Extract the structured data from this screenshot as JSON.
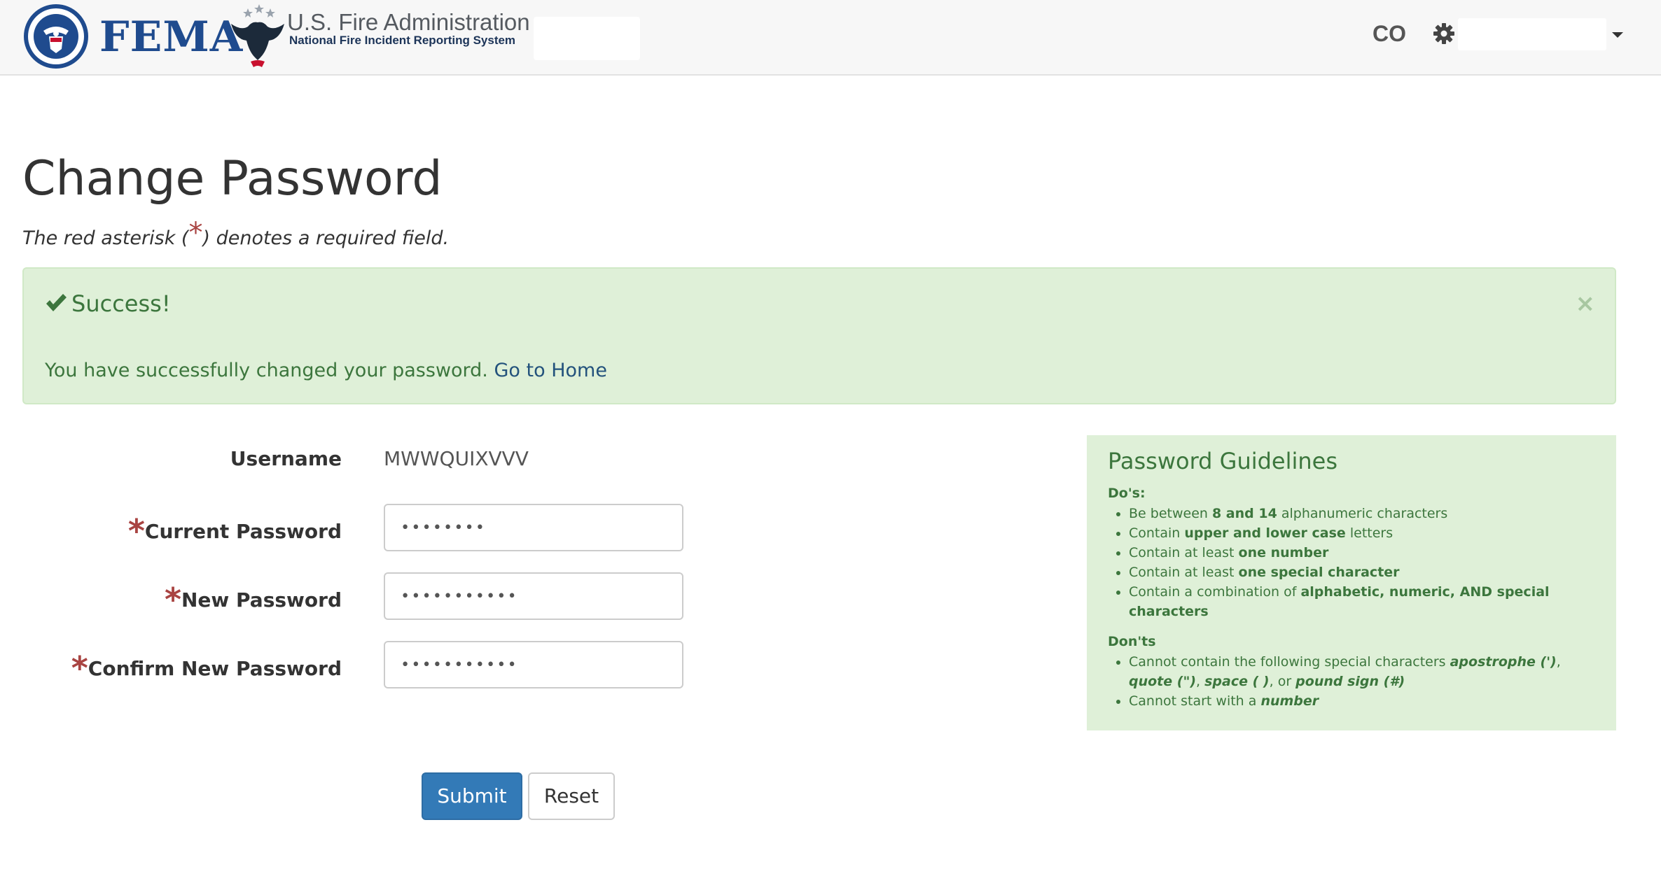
{
  "header": {
    "fema_wordmark": "FEMA",
    "usfa_title": "U.S. Fire Administration",
    "usfa_subtitle": "National Fire Incident Reporting System",
    "state_code": "CO",
    "icons": {
      "settings": "gear-icon",
      "user_menu": "caret-down-icon"
    }
  },
  "page": {
    "title": "Change Password",
    "required_note_prefix": "The red asterisk (",
    "required_note_asterisk": "*",
    "required_note_suffix": ") denotes a required field."
  },
  "alert": {
    "title": "Success!",
    "close_label": "×",
    "message": "You have successfully changed your password.",
    "link_text": "Go to Home",
    "icons": {
      "status": "check-icon",
      "close": "close-icon"
    }
  },
  "form": {
    "asterisk": "*",
    "username_label": "Username",
    "username_value": "MWWQUIXVVV",
    "current_password_label": "Current Password",
    "current_password_value": "••••••••",
    "new_password_label": "New Password",
    "new_password_value": "•••••••••••",
    "confirm_password_label": "Confirm New Password",
    "confirm_password_value": "•••••••••••",
    "submit_label": "Submit",
    "reset_label": "Reset"
  },
  "guidelines": {
    "title": "Password Guidelines",
    "dos_title": "Do's:",
    "dos": [
      {
        "pre": "Be between ",
        "strong": "8 and 14",
        "post": " alphanumeric characters"
      },
      {
        "pre": "Contain ",
        "strong": "upper and lower case",
        "post": " letters"
      },
      {
        "pre": "Contain at least ",
        "strong": "one number",
        "post": ""
      },
      {
        "pre": "Contain at least ",
        "strong": "one special character",
        "post": ""
      },
      {
        "pre": "Contain a combination of ",
        "strong": "alphabetic, numeric, AND special characters",
        "post": ""
      }
    ],
    "donts_title": "Don'ts",
    "donts_1": {
      "pre": "Cannot contain the following special characters ",
      "s1": "apostrophe (')",
      "sep1": ", ",
      "s2": "quote (\")",
      "sep2": ", ",
      "s3": "space ( )",
      "sep3": ", or ",
      "s4": "pound sign (#)"
    },
    "donts_2": {
      "pre": "Cannot start with a ",
      "strong": "number"
    }
  },
  "colors": {
    "brand_blue": "#1f4b8e",
    "success_bg": "#dff0d8",
    "success_text": "#3c763d",
    "required_red": "#a94442",
    "primary_button": "#337ab7"
  }
}
